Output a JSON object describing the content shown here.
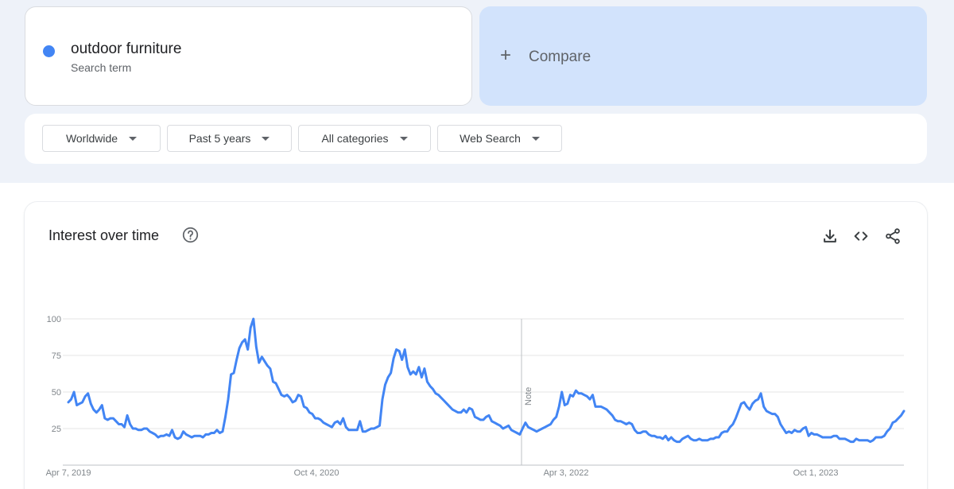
{
  "search": {
    "term": "outdoor furniture",
    "subtitle": "Search term",
    "term_color": "#4285f4"
  },
  "compare": {
    "plus": "+",
    "label": "Compare",
    "bg_color": "#d2e3fc"
  },
  "filters": [
    {
      "label": "Worldwide"
    },
    {
      "label": "Past 5 years"
    },
    {
      "label": "All categories"
    },
    {
      "label": "Web Search"
    }
  ],
  "card": {
    "title": "Interest over time",
    "icons": [
      "help-icon",
      "download-icon",
      "embed-icon",
      "share-icon"
    ]
  },
  "chart_data": {
    "type": "line",
    "title": "Interest over time",
    "xlabel": "",
    "ylabel": "",
    "ylim": [
      0,
      100
    ],
    "yticks": [
      25,
      50,
      75,
      100
    ],
    "xtick_labels": [
      "Apr 7, 2019",
      "Oct 4, 2020",
      "Apr 3, 2022",
      "Oct 1, 2023"
    ],
    "annotation": {
      "label": "Note",
      "x": "2021-11-28"
    },
    "grid": true,
    "line_color": "#4285f4",
    "series": [
      {
        "name": "outdoor furniture",
        "values": [
          43,
          45,
          50,
          41,
          42,
          43,
          47,
          49,
          42,
          38,
          36,
          38,
          41,
          32,
          31,
          32,
          32,
          30,
          28,
          28,
          26,
          34,
          28,
          25,
          25,
          24,
          24,
          25,
          25,
          23,
          22,
          21,
          19,
          20,
          20,
          21,
          20,
          24,
          19,
          18,
          19,
          23,
          21,
          20,
          19,
          20,
          20,
          20,
          19,
          21,
          21,
          22,
          22,
          24,
          22,
          23,
          33,
          45,
          62,
          63,
          72,
          80,
          84,
          86,
          79,
          94,
          100,
          81,
          70,
          74,
          71,
          68,
          66,
          57,
          56,
          52,
          48,
          47,
          48,
          46,
          43,
          44,
          48,
          47,
          40,
          39,
          36,
          35,
          32,
          32,
          31,
          29,
          28,
          27,
          26,
          29,
          30,
          28,
          32,
          26,
          24,
          24,
          24,
          24,
          30,
          23,
          23,
          24,
          25,
          25,
          26,
          27,
          45,
          55,
          60,
          63,
          73,
          79,
          78,
          72,
          79,
          67,
          62,
          64,
          62,
          67,
          60,
          66,
          57,
          54,
          52,
          49,
          48,
          46,
          44,
          42,
          40,
          38,
          37,
          36,
          36,
          38,
          36,
          39,
          38,
          33,
          32,
          31,
          31,
          33,
          34,
          30,
          29,
          28,
          27,
          25,
          26,
          27,
          24,
          23,
          22,
          21,
          25,
          29,
          26,
          25,
          24,
          23,
          24,
          25,
          26,
          27,
          28,
          31,
          33,
          40,
          50,
          41,
          42,
          48,
          47,
          51,
          49,
          49,
          48,
          47,
          45,
          48,
          40,
          40,
          40,
          39,
          38,
          36,
          34,
          31,
          30,
          30,
          29,
          28,
          29,
          28,
          24,
          22,
          22,
          23,
          23,
          21,
          20,
          20,
          19,
          19,
          18,
          20,
          17,
          19,
          17,
          16,
          16,
          18,
          19,
          20,
          18,
          17,
          17,
          18,
          17,
          17,
          17,
          18,
          18,
          19,
          19,
          22,
          23,
          23,
          26,
          28,
          32,
          37,
          42,
          43,
          40,
          38,
          42,
          44,
          45,
          49,
          40,
          37,
          36,
          35,
          35,
          33,
          28,
          25,
          22,
          23,
          22,
          24,
          23,
          23,
          25,
          26,
          20,
          22,
          21,
          21,
          20,
          19,
          19,
          19,
          19,
          20,
          20,
          18,
          18,
          18,
          17,
          16,
          16,
          18,
          17,
          17,
          17,
          17,
          16,
          17,
          19,
          19,
          19,
          20,
          23,
          25,
          29,
          30,
          32,
          34,
          37
        ]
      }
    ]
  }
}
